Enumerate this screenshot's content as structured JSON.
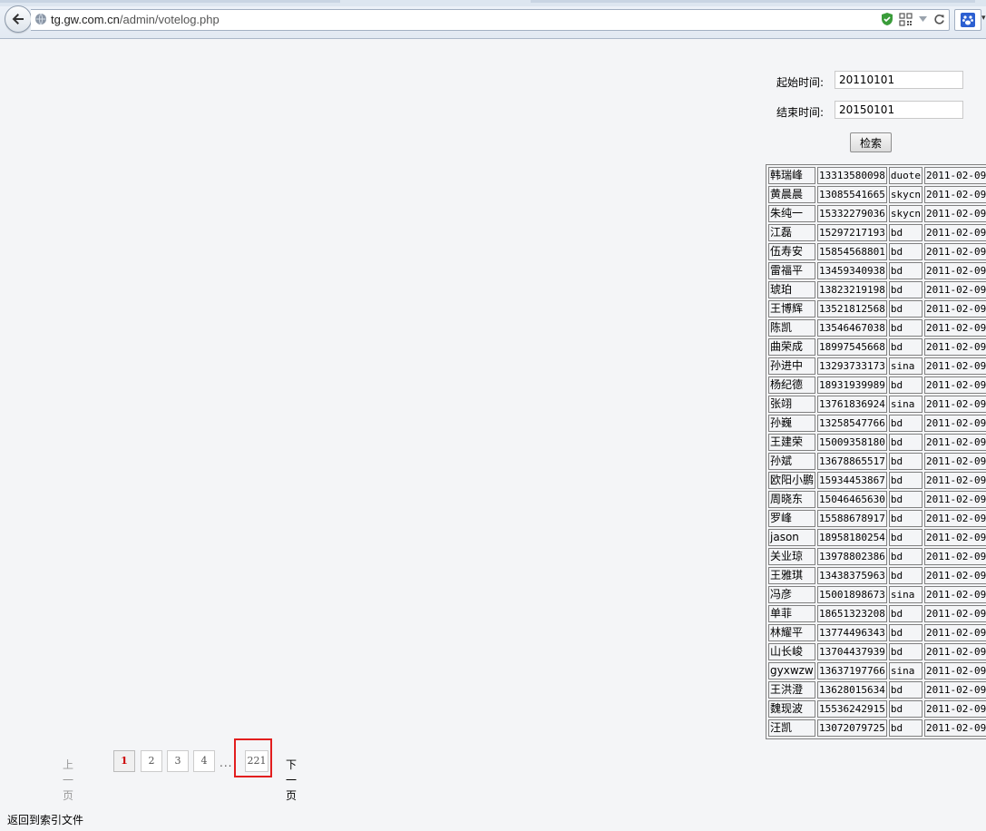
{
  "browser": {
    "url": "tg.gw.com.cn/admin/votelog.php",
    "url_host": "tg.gw.com.cn",
    "url_path": "/admin/votelog.php",
    "icons": [
      "back-arrow-icon",
      "globe-icon",
      "shield-check-icon",
      "qr-code-icon",
      "dropdown-icon",
      "refresh-icon",
      "paw-icon"
    ]
  },
  "form": {
    "start_label": "起始时间:",
    "start_value": "20110101",
    "end_label": "结束时间:",
    "end_value": "20150101",
    "search_label": "检索"
  },
  "log_rows": [
    [
      "韩瑞峰",
      "13313580098",
      "duote",
      "2011-02-09"
    ],
    [
      "黄晨晨",
      "13085541665",
      "skycn",
      "2011-02-09"
    ],
    [
      "朱纯一",
      "15332279036",
      "skycn",
      "2011-02-09"
    ],
    [
      "江磊",
      "15297217193",
      "bd",
      "2011-02-09"
    ],
    [
      "伍寿安",
      "15854568801",
      "bd",
      "2011-02-09"
    ],
    [
      "雷福平",
      "13459340938",
      "bd",
      "2011-02-09"
    ],
    [
      "琥珀",
      "13823219198",
      "bd",
      "2011-02-09"
    ],
    [
      "王博辉",
      "13521812568",
      "bd",
      "2011-02-09"
    ],
    [
      "陈凯",
      "13546467038",
      "bd",
      "2011-02-09"
    ],
    [
      "曲荣成",
      "18997545668",
      "bd",
      "2011-02-09"
    ],
    [
      "孙进中",
      "13293733173",
      "sina",
      "2011-02-09"
    ],
    [
      "杨纪德",
      "18931939989",
      "bd",
      "2011-02-09"
    ],
    [
      "张翊",
      "13761836924",
      "sina",
      "2011-02-09"
    ],
    [
      "孙巍",
      "13258547766",
      "bd",
      "2011-02-09"
    ],
    [
      "王建荣",
      "15009358180",
      "bd",
      "2011-02-09"
    ],
    [
      "孙斌",
      "13678865517",
      "bd",
      "2011-02-09"
    ],
    [
      "欧阳小鹏",
      "15934453867",
      "bd",
      "2011-02-09"
    ],
    [
      "周晓东",
      "15046465630",
      "bd",
      "2011-02-09"
    ],
    [
      "罗峰",
      "15588678917",
      "bd",
      "2011-02-09"
    ],
    [
      "jason",
      "18958180254",
      "bd",
      "2011-02-09"
    ],
    [
      "关业琼",
      "13978802386",
      "bd",
      "2011-02-09"
    ],
    [
      "王雅琪",
      "13438375963",
      "bd",
      "2011-02-09"
    ],
    [
      "冯彦",
      "15001898673",
      "sina",
      "2011-02-09"
    ],
    [
      "单菲",
      "18651323208",
      "bd",
      "2011-02-09"
    ],
    [
      "林耀平",
      "13774496343",
      "bd",
      "2011-02-09"
    ],
    [
      "山长峻",
      "13704437939",
      "bd",
      "2011-02-09"
    ],
    [
      "gyxwzw",
      "13637197766",
      "sina",
      "2011-02-09"
    ],
    [
      "王洪澄",
      "13628015634",
      "bd",
      "2011-02-09"
    ],
    [
      "魏现波",
      "15536242915",
      "bd",
      "2011-02-09"
    ],
    [
      "汪凯",
      "13072079725",
      "bd",
      "2011-02-09"
    ]
  ],
  "pager": {
    "prev_label": "上一页",
    "pages": [
      "1",
      "2",
      "3",
      "4"
    ],
    "current": "1",
    "dots": "...",
    "last": "221",
    "next_label": "下一页"
  },
  "footer": {
    "back_link": "返回到索引文件"
  },
  "colors": {
    "highlight": "#e21e1e",
    "current_page": "#cc0000"
  }
}
